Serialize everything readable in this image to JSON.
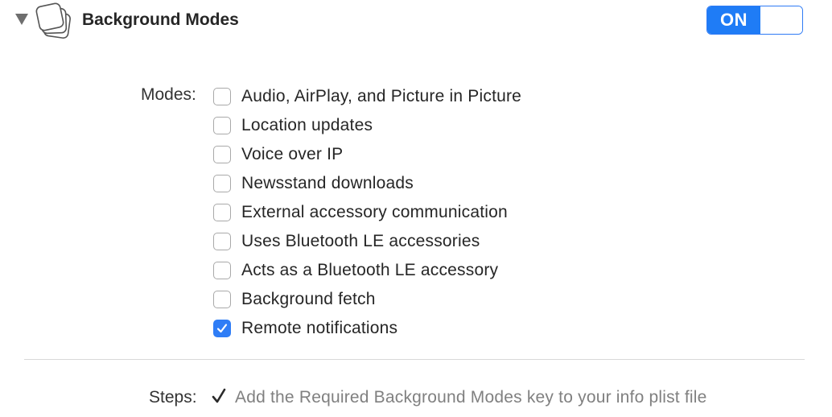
{
  "header": {
    "title": "Background Modes",
    "disclosure_icon": "disclosure-triangle-down-icon",
    "capability_icon": "stacked-windows-icon",
    "toggle": {
      "label": "ON",
      "state": "on",
      "accent": "#1f7cf6"
    }
  },
  "modes": {
    "label": "Modes:",
    "items": [
      {
        "label": "Audio, AirPlay, and Picture in Picture",
        "checked": false
      },
      {
        "label": "Location updates",
        "checked": false
      },
      {
        "label": "Voice over IP",
        "checked": false
      },
      {
        "label": "Newsstand downloads",
        "checked": false
      },
      {
        "label": "External accessory communication",
        "checked": false
      },
      {
        "label": "Uses Bluetooth LE accessories",
        "checked": false
      },
      {
        "label": "Acts as a Bluetooth LE accessory",
        "checked": false
      },
      {
        "label": "Background fetch",
        "checked": false
      },
      {
        "label": "Remote notifications",
        "checked": true
      }
    ]
  },
  "steps": {
    "label": "Steps:",
    "icon": "checkmark-icon",
    "items": [
      {
        "text": "Add the Required Background Modes key to your info plist file"
      }
    ]
  }
}
